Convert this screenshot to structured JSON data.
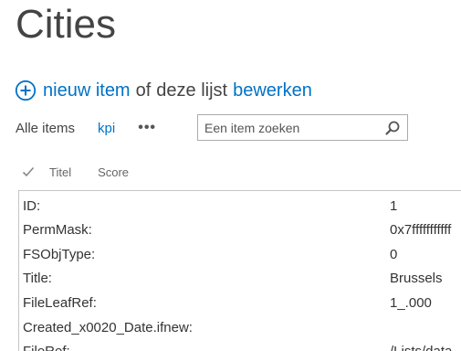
{
  "page": {
    "title": "Cities"
  },
  "commands": {
    "new_item": "nieuw item",
    "or": "of",
    "this_list": "deze lijst",
    "edit": "bewerken"
  },
  "views": {
    "all_items": "Alle items",
    "kpi": "kpi",
    "more": "•••"
  },
  "search": {
    "placeholder": "Een item zoeken"
  },
  "columns": {
    "title": "Titel",
    "score": "Score"
  },
  "details": [
    {
      "key": "ID:",
      "value": "1"
    },
    {
      "key": "PermMask:",
      "value": "0x7fffffffffff"
    },
    {
      "key": "FSObjType:",
      "value": "0"
    },
    {
      "key": "Title:",
      "value": "Brussels"
    },
    {
      "key": "FileLeafRef:",
      "value": "1_.000"
    },
    {
      "key": "Created_x0020_Date.ifnew:",
      "value": ""
    },
    {
      "key": "FileRef:",
      "value": "/Lists/data"
    }
  ],
  "colors": {
    "accent": "#0072c6",
    "text": "#444444",
    "border": "#c6c6c6"
  }
}
